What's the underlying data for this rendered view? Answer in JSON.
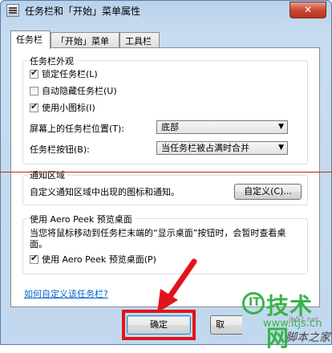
{
  "window": {
    "title": "任务栏和「开始」菜单属性",
    "close_label": "✕"
  },
  "tabs": [
    {
      "label": "任务栏"
    },
    {
      "label": "「开始」菜单"
    },
    {
      "label": "工具栏"
    }
  ],
  "appearance": {
    "title": "任务栏外观",
    "checkboxes": [
      {
        "label": "锁定任务栏(L)",
        "checked": true
      },
      {
        "label": "自动隐藏任务栏(U)",
        "checked": false
      },
      {
        "label": "使用小图标(I)",
        "checked": true
      }
    ],
    "position_label": "屏幕上的任务栏位置(T):",
    "position_value": "底部",
    "buttons_label": "任务栏按钮(B):",
    "buttons_value": "当任务栏被占满时合并"
  },
  "notification": {
    "title": "通知区域",
    "description": "自定义通知区域中出现的图标和通知。",
    "customize_button": "自定义(C)..."
  },
  "aero_peek": {
    "title": "使用 Aero Peek 预览桌面",
    "description": "当您将鼠标移动到任务栏末端的“显示桌面”按钮时，会暂时查看桌面。",
    "checkbox_label": "使用 Aero Peek 预览桌面(P)",
    "checked": true
  },
  "help_link": "如何自定义该任务栏?",
  "footer": {
    "ok_label": "确定",
    "cancel_label": "取"
  },
  "watermark": {
    "logo": "IT",
    "text": "技术网",
    "url": "www.itjs.cn",
    "small": "jb51.net",
    "brand": "脚本之家"
  },
  "colors": {
    "annotation_red": "#e0151b",
    "link": "#0066cc",
    "watermark_green": "#38b34a"
  }
}
